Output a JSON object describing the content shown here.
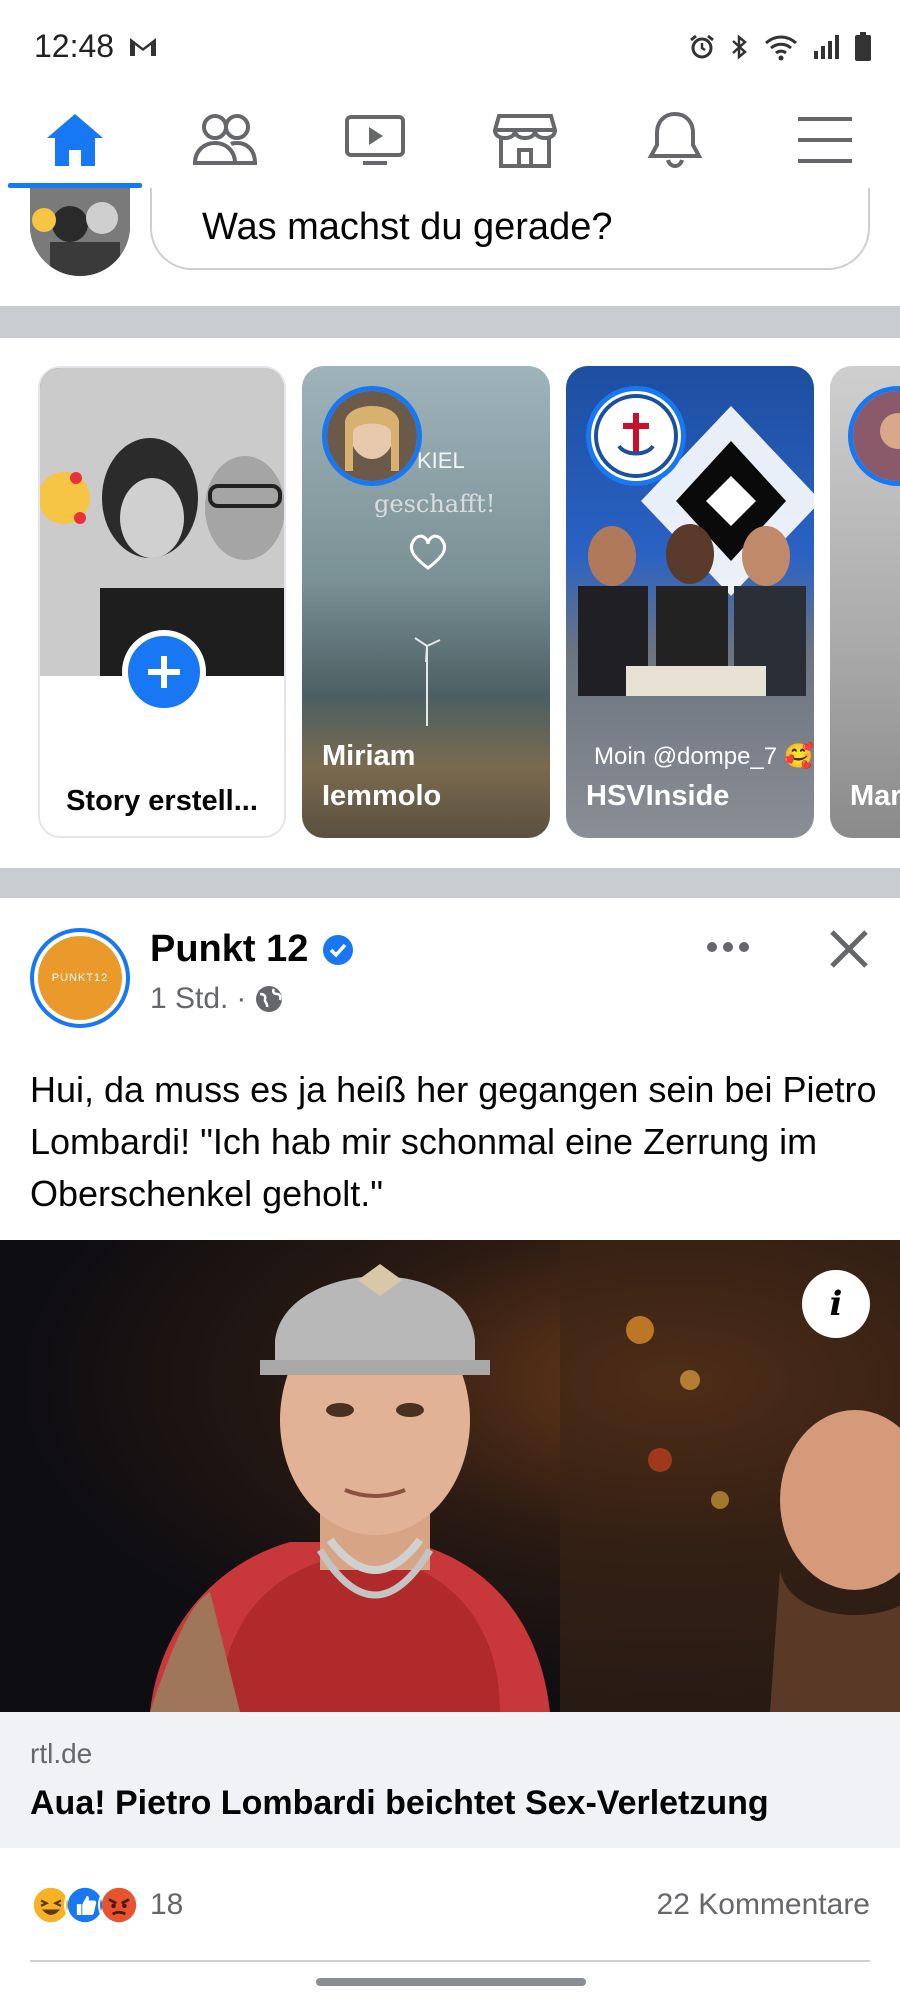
{
  "status_bar": {
    "time": "12:48",
    "icons": [
      "gmail-icon",
      "alarm-icon",
      "bluetooth-icon",
      "wifi-icon",
      "signal-icon",
      "battery-icon"
    ]
  },
  "nav": {
    "items": [
      {
        "name": "home",
        "icon": "home-icon",
        "active": true
      },
      {
        "name": "friends",
        "icon": "friends-icon",
        "active": false
      },
      {
        "name": "watch",
        "icon": "video-icon",
        "active": false
      },
      {
        "name": "marketplace",
        "icon": "marketplace-icon",
        "active": false
      },
      {
        "name": "notifications",
        "icon": "bell-icon",
        "active": false
      },
      {
        "name": "menu",
        "icon": "hamburger-icon",
        "active": false
      }
    ],
    "accent": "#1877f2"
  },
  "composer": {
    "placeholder": "Was machst du gerade?"
  },
  "stories": {
    "create_label": "Story erstell...",
    "items": [
      {
        "name": "Miriam\nIemmolo",
        "name_line1": "Miriam",
        "name_line2": "Iemmolo",
        "overlay_text": "KIEL",
        "overlay_text2": "geschafft!"
      },
      {
        "name": "HSVInside",
        "caption": "Moin @dompe_7 🥰"
      },
      {
        "name": "Mar"
      }
    ]
  },
  "post": {
    "page_name": "Punkt 12",
    "page_logo_text": "PUNKT12",
    "time": "1 Std.",
    "text": "Hui, da muss es ja heiß her gegangen sein bei Pietro Lombardi! \"Ich hab mir schonmal eine Zerrung im Oberschenkel geholt.\"",
    "link": {
      "domain": "rtl.de",
      "title": "Aua! Pietro Lombardi beichtet Sex-Verletzung"
    },
    "reaction_count": "18",
    "comments": "22 Kommentare",
    "info_label": "i"
  }
}
